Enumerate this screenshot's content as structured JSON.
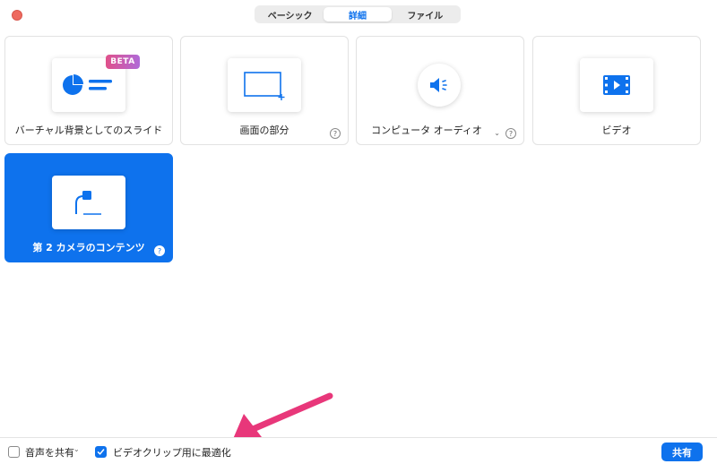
{
  "tabs": [
    {
      "label": "ベーシック",
      "active": false
    },
    {
      "label": "詳細",
      "active": true
    },
    {
      "label": "ファイル",
      "active": false
    }
  ],
  "cards": {
    "virtual_bg": {
      "label": "バーチャル背景としてのスライド",
      "badge": "BETA",
      "icon": "slide-chart-icon"
    },
    "portion": {
      "label": "画面の部分",
      "icon": "screen-portion-icon"
    },
    "audio": {
      "label": "コンピュータ オーディオ",
      "icon": "speaker-icon"
    },
    "video": {
      "label": "ビデオ",
      "icon": "film-play-icon"
    },
    "camera2": {
      "label": "第 2 カメラのコンテンツ",
      "icon": "document-camera-icon",
      "selected": true
    }
  },
  "help_glyph": "?",
  "footer": {
    "share_audio_label": "音声を共有",
    "share_audio_checked": false,
    "optimize_label": "ビデオクリップ用に最適化",
    "optimize_checked": true,
    "share_button": "共有"
  },
  "colors": {
    "accent": "#0e72ed",
    "close": "#ee6a5f",
    "annotation_arrow": "#e8377a",
    "beta_gradient": [
      "#e0508a",
      "#b06ad8"
    ]
  }
}
